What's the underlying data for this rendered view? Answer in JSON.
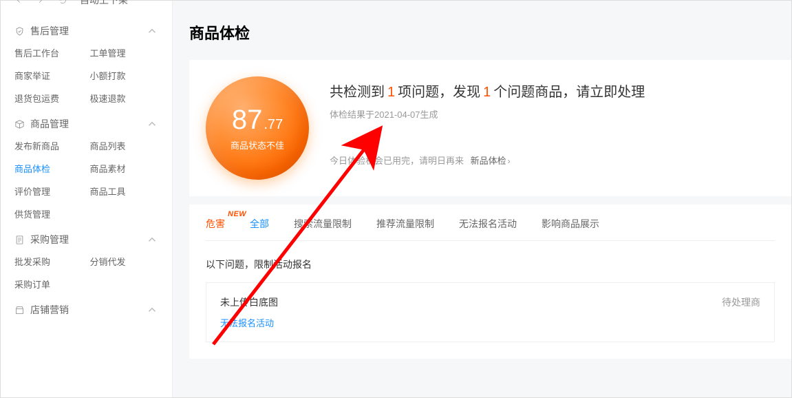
{
  "topbar": {
    "truncated": "自动上下架"
  },
  "sidebar": [
    {
      "icon": "shield",
      "title": "售后管理",
      "items": [
        {
          "label": "售后工作台"
        },
        {
          "label": "工单管理"
        },
        {
          "label": "商家举证"
        },
        {
          "label": "小额打款"
        },
        {
          "label": "退货包运费"
        },
        {
          "label": "极速退款"
        }
      ]
    },
    {
      "icon": "box",
      "title": "商品管理",
      "items": [
        {
          "label": "发布新商品"
        },
        {
          "label": "商品列表"
        },
        {
          "label": "商品体检",
          "active": true
        },
        {
          "label": "商品素材"
        },
        {
          "label": "评价管理"
        },
        {
          "label": "商品工具"
        },
        {
          "label": "供货管理"
        }
      ]
    },
    {
      "icon": "file",
      "title": "采购管理",
      "items": [
        {
          "label": "批发采购"
        },
        {
          "label": "分销代发"
        },
        {
          "label": "采购订单"
        }
      ]
    },
    {
      "icon": "store",
      "title": "店铺营销",
      "items": []
    }
  ],
  "page_title": "商品体检",
  "score": {
    "int": "87",
    "dec": ".77",
    "label": "商品状态不佳"
  },
  "summary": {
    "before1": "共检测到",
    "count1": "1",
    "mid1": "项问题，发现",
    "count2": "1",
    "after1": "个问题商品，请立即处理",
    "sub": "体检结果于2021-04-07生成",
    "tip_a": "今日体验机会已用完，请明日再来",
    "tip_b": "新品体检"
  },
  "tabs": {
    "danger": "危害",
    "new_badge": "NEW",
    "items": [
      "全部",
      "搜索流量限制",
      "推荐流量限制",
      "无法报名活动",
      "影响商品展示"
    ]
  },
  "issues": {
    "heading": "以下问题，限制活动报名",
    "name": "未上传白底图",
    "tag": "无法报名活动",
    "right": "待处理商"
  }
}
